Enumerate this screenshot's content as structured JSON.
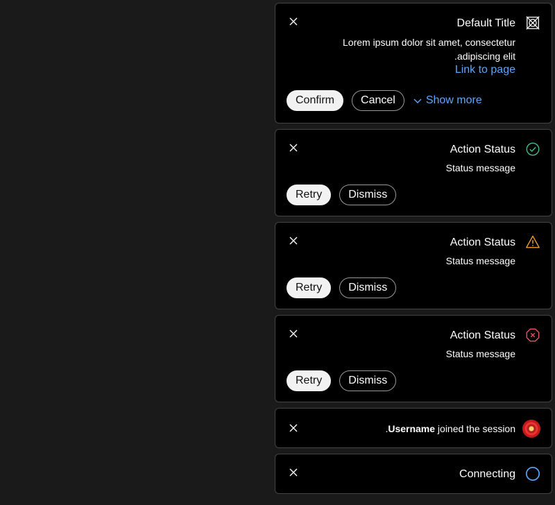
{
  "toasts": {
    "default": {
      "title": "Default Title",
      "message": "Lorem ipsum dolor sit amet, consectetur adipiscing elit.",
      "link": "Link to page",
      "confirm": "Confirm",
      "cancel": "Cancel",
      "show_more": "Show more",
      "icon": "broken-image-icon"
    },
    "success": {
      "title": "Action Status",
      "message": "Status message",
      "retry": "Retry",
      "dismiss": "Dismiss",
      "icon": "check-circle-icon",
      "color": "#3cc28b"
    },
    "warning": {
      "title": "Action Status",
      "message": "Status message",
      "retry": "Retry",
      "dismiss": "Dismiss",
      "icon": "warning-triangle-icon",
      "color": "#f0a22b"
    },
    "error": {
      "title": "Action Status",
      "message": "Status message",
      "retry": "Retry",
      "dismiss": "Dismiss",
      "icon": "error-octagon-icon",
      "color": "#e8555d"
    },
    "join": {
      "username": "Username",
      "text": "joined the session",
      "period": ".",
      "icon": "avatar"
    },
    "connecting": {
      "title": "Connecting",
      "icon": "spinner-icon",
      "color": "#5ba7ff"
    }
  },
  "colors": {
    "background": "#1a1a1a",
    "toast_background": "#000000",
    "border": "#444444",
    "link": "#5ba7ff"
  }
}
